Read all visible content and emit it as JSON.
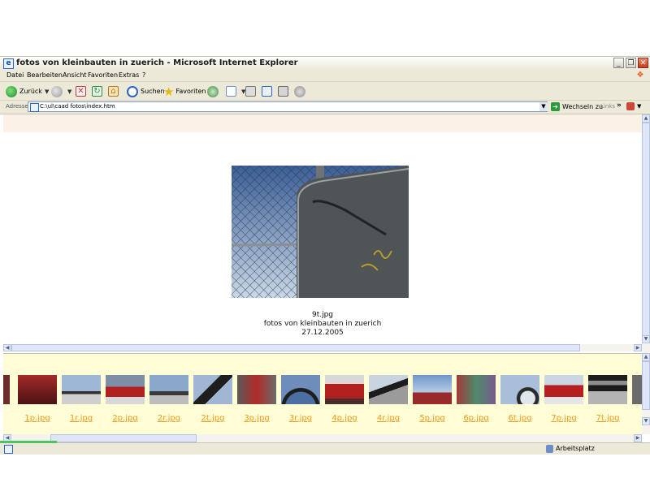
{
  "window": {
    "title": "fotos von kleinbauten in zuerich - Microsoft Internet Explorer",
    "controls": {
      "minimize": "_",
      "maximize": "❐",
      "close": "✕"
    }
  },
  "menu": [
    "Datei",
    "Bearbeiten",
    "Ansicht",
    "Favoriten",
    "Extras",
    "?"
  ],
  "toolbar": {
    "back": "Zurück",
    "search": "Suchen",
    "favorites": "Favoriten"
  },
  "address": {
    "label": "Adresse",
    "value": "C:\\ul\\caad fotos\\index.htm",
    "go": "Wechseln zu",
    "links": "Links"
  },
  "photo": {
    "filename": "9t.jpg",
    "title": "fotos von kleinbauten in zuerich",
    "date": "27.12.2005"
  },
  "thumbnails": [
    {
      "label": ""
    },
    {
      "label": "1p.jpg"
    },
    {
      "label": "1r.jpg"
    },
    {
      "label": "2p.jpg"
    },
    {
      "label": "2r.jpg"
    },
    {
      "label": "2t.jpg"
    },
    {
      "label": "3p.jpg"
    },
    {
      "label": "3r.jpg"
    },
    {
      "label": "4p.jpg"
    },
    {
      "label": "4r.jpg"
    },
    {
      "label": "5p.jpg"
    },
    {
      "label": "6p.jpg"
    },
    {
      "label": "6t.jpg"
    },
    {
      "label": "7p.jpg"
    },
    {
      "label": "7t.jpg"
    }
  ],
  "status": {
    "zone": "Arbeitsplatz"
  },
  "colors": {
    "titlebar": "#ece9d8",
    "thumb_strip_bg": "#fffdd6",
    "link": "#f09a1c",
    "top_strip": "#fbf1e6"
  }
}
